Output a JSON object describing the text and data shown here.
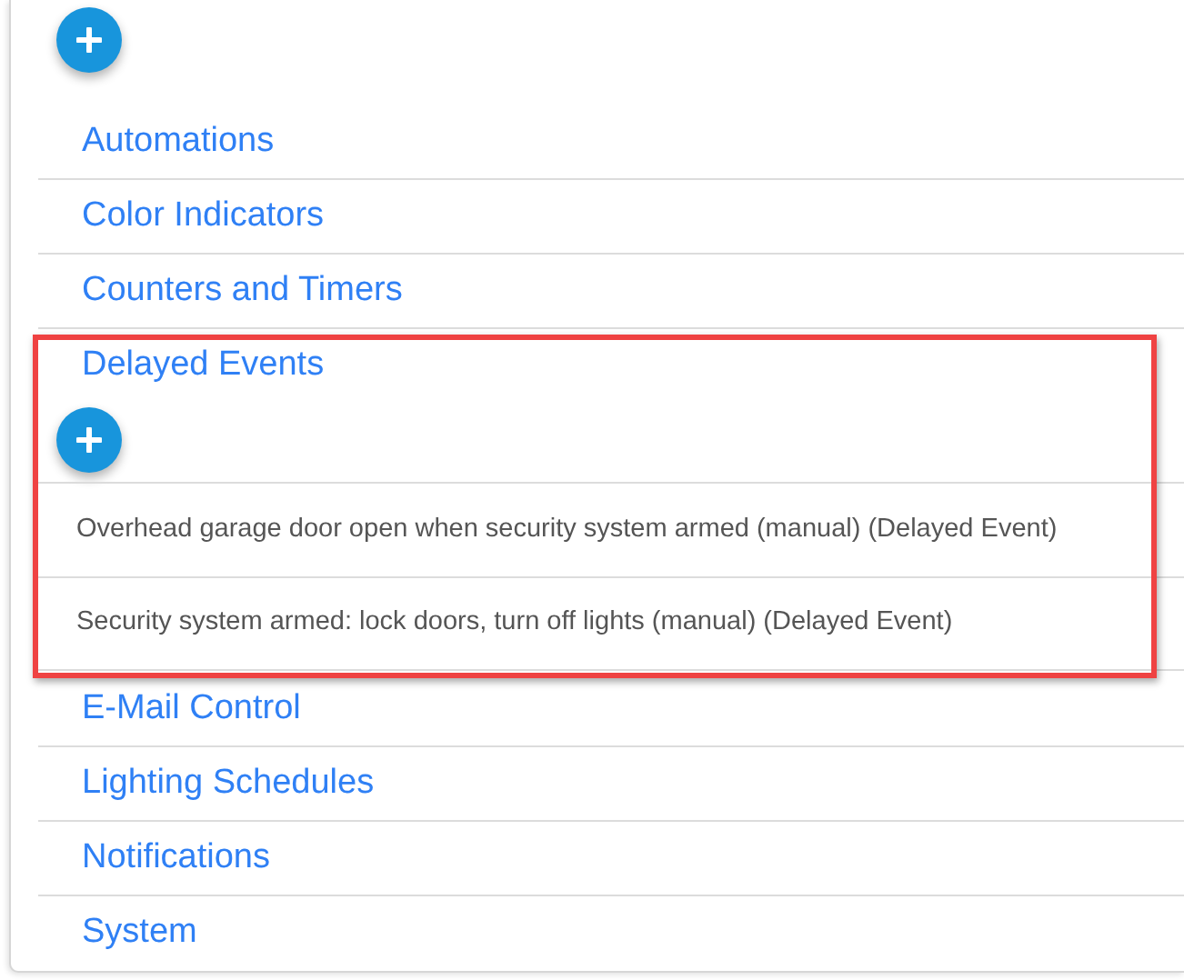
{
  "categories": [
    {
      "label": "Automations",
      "expanded": false
    },
    {
      "label": "Color Indicators",
      "expanded": false
    },
    {
      "label": "Counters and Timers",
      "expanded": false
    },
    {
      "label": "Delayed Events",
      "expanded": true,
      "highlighted": true,
      "items": [
        {
          "label": "Overhead garage door open when security system armed (manual) (Delayed Event)"
        },
        {
          "label": "Security system armed: lock doors, turn off lights (manual) (Delayed Event)"
        }
      ]
    },
    {
      "label": "E-Mail Control",
      "expanded": false
    },
    {
      "label": "Lighting Schedules",
      "expanded": false
    },
    {
      "label": "Notifications",
      "expanded": false
    },
    {
      "label": "System",
      "expanded": false
    }
  ]
}
